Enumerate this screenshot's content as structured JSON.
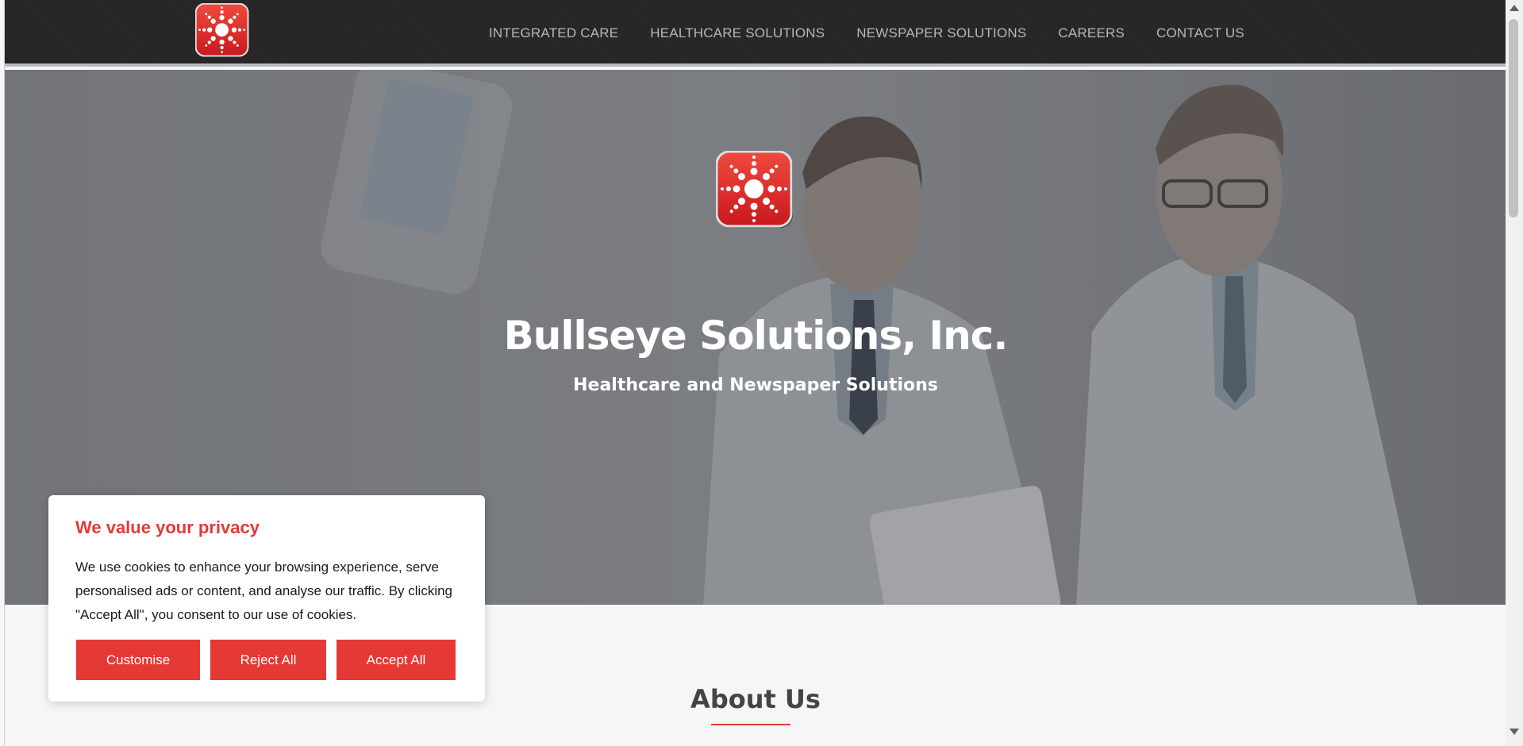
{
  "nav": {
    "items": [
      {
        "label": "INTEGRATED CARE"
      },
      {
        "label": "HEALTHCARE SOLUTIONS"
      },
      {
        "label": "NEWSPAPER SOLUTIONS"
      },
      {
        "label": "CAREERS"
      },
      {
        "label": "CONTACT US"
      }
    ]
  },
  "hero": {
    "title": "Bullseye Solutions, Inc.",
    "subtitle": "Healthcare and Newspaper Solutions"
  },
  "about": {
    "heading": "About Us"
  },
  "cookie": {
    "title": "We value your privacy",
    "text": "We use cookies to enhance your browsing experience, serve personalised ads or content, and analyse our traffic. By clicking \"Accept All\", you consent to our use of cookies.",
    "buttons": {
      "customise": "Customise",
      "reject": "Reject All",
      "accept": "Accept All"
    }
  },
  "colors": {
    "accent": "#e53935",
    "navbar": "#262626",
    "nav_text": "#b8b8b8"
  },
  "icons": {
    "logo": "starburst-logo-icon"
  }
}
